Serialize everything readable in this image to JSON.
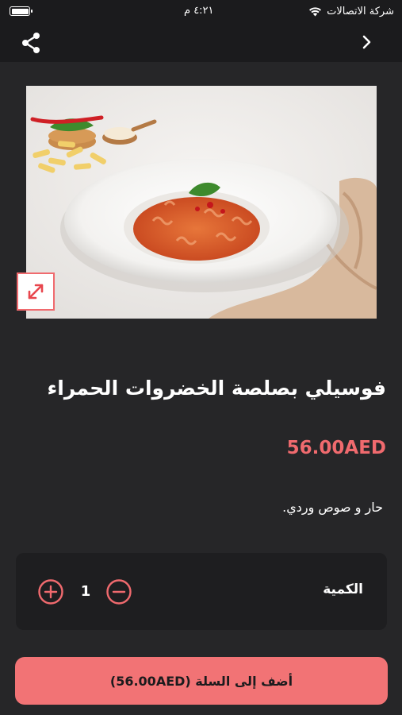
{
  "status_bar": {
    "carrier": "شركة الاتصالات",
    "time": "٤:٢١ م",
    "icons": [
      "wifi-icon",
      "battery-icon"
    ]
  },
  "nav": {
    "icons": [
      "share-icon",
      "chevron-right-icon"
    ]
  },
  "product": {
    "image_alt": "fusilli-pasta-photo",
    "title": "فوسيلي بصلصة الخضروات الحمراء",
    "price": "56.00AED",
    "description": "حار و صوص وردي."
  },
  "quantity": {
    "label": "الكمية",
    "value": "1",
    "icons": [
      "plus-circle-icon",
      "minus-circle-icon"
    ]
  },
  "cart": {
    "button_label": "أضف إلى السلة (56.00AED)"
  },
  "colors": {
    "background": "#262628",
    "bar": "#1b1b1d",
    "accent": "#f06a6e",
    "button": "#f27375",
    "card": "#1e1e20"
  }
}
